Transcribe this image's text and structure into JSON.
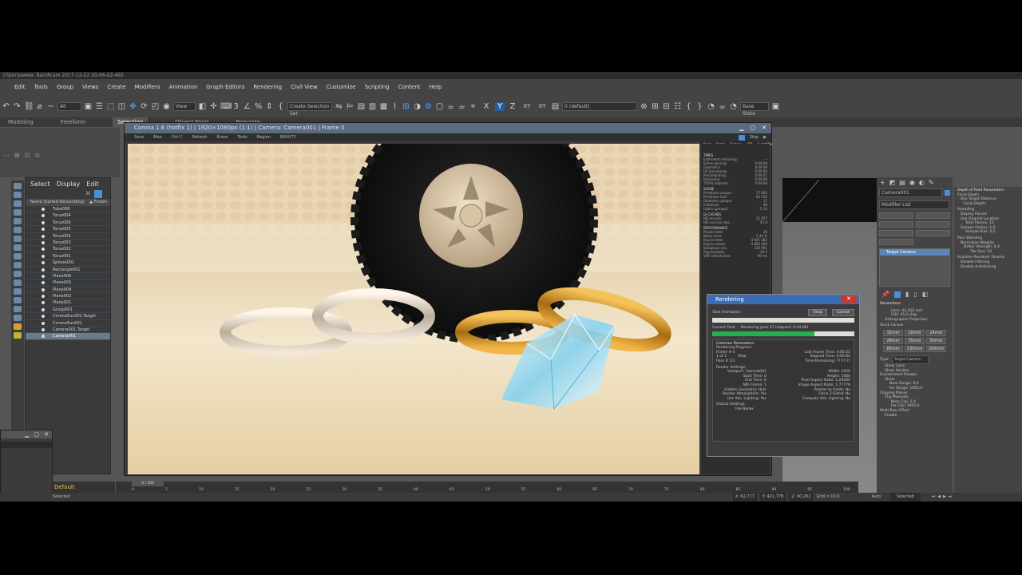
{
  "app": {
    "title": "[Программа: Bandicam 2017-12-22 20-06-02-492"
  },
  "menu": [
    "Edit",
    "Tools",
    "Group",
    "Views",
    "Create",
    "Modifiers",
    "Animation",
    "Graph Editors",
    "Rendering",
    "Civil View",
    "Customize",
    "Scripting",
    "Content",
    "Help"
  ],
  "toolbar": {
    "selection_filter": "All",
    "ref_coord": "View",
    "named_selection": "Create Selection Set",
    "axes": [
      "X",
      "Y",
      "Z",
      "XY",
      "XY"
    ],
    "layer": "0 (default)",
    "state": "Base State"
  },
  "ribbon": {
    "tabs": [
      "Modeling",
      "Freeform",
      "Selection",
      "Object Paint",
      "Populate"
    ]
  },
  "scene_explorer": {
    "tabs": [
      "Select",
      "Display",
      "Edit"
    ],
    "column_name": "Name (Sorted Descending)",
    "column_frozen": "▲ Frozen",
    "items": [
      "Tube008",
      "Torus004",
      "Torus006",
      "Torus005",
      "Torus004",
      "Torus003",
      "Torus002",
      "Torus001",
      "Sphere001",
      "Rectangle001",
      "Plane006",
      "Plane005",
      "Plane004",
      "Plane002",
      "Plane001",
      "Group001",
      "CoronaSun001.Target",
      "CoronaSun001",
      "Camera001.Target",
      "Camera001"
    ],
    "selected": "Camera001"
  },
  "vfb": {
    "title": "Corona 1.6 (hotfix 1) | 1920×1080px (1:1) | Camera: Camera001 | Frame 0",
    "tools": [
      "Save",
      "Max",
      "Ctrl C",
      "Refresh",
      "Erase",
      "Tools",
      "Region",
      "BEAUTY"
    ],
    "right_tabs": [
      "Post",
      "Stats",
      "History",
      "DR",
      "LightMix"
    ],
    "stop": "Stop",
    "stats": {
      "times_header": "TIMES",
      "times": [
        [
          "Estimated remaining:",
          "---"
        ],
        [
          "Scene parsing:",
          "0:00:00"
        ],
        [
          "Geometry:",
          "0:00:00"
        ],
        [
          "UV processing:",
          "0:00:00"
        ],
        [
          "Precomputing:",
          "0:00:01"
        ],
        [
          "Denoising:",
          "0:00:00"
        ],
        [
          "TOTAL elapsed:",
          "0:04:06"
        ]
      ],
      "scene_header": "SCENE",
      "scene": [
        [
          "Primitives unique:",
          "77 802"
        ],
        [
          "Primitives inst.:",
          "83 156"
        ],
        [
          "Geometry groups:",
          "11"
        ],
        [
          "Instances:",
          "98"
        ],
        [
          "Lights (groups):",
          "2 (1)"
        ]
      ],
      "cache_header": "GI CACHES",
      "cache": [
        [
          "HD records:",
          "21 877"
        ],
        [
          "HD success rate:",
          "97.8"
        ]
      ],
      "perf_header": "PERFORMANCE",
      "perf": [
        [
          "Passes total:",
          "26"
        ],
        [
          "Noise level:",
          "5.41 %"
        ],
        [
          "Rays/s total:",
          "4 921 282"
        ],
        [
          "Rays/s actual:",
          "4 865 400"
        ],
        [
          "Samples/s act.:",
          "234 591"
        ],
        [
          "Rays/sample:",
          "20.0"
        ],
        [
          "VFB refresh time:",
          "99 ms"
        ]
      ]
    }
  },
  "render_dialog": {
    "title": "Rendering",
    "total_animation": "Total Animation:",
    "current_task_label": "Current Task:",
    "current_task": "Rendering pass 27 (elapsed: 0:04:06)",
    "progress": 0.72,
    "pause": "Stop",
    "cancel": "Cancel",
    "common_params": "Common Parameters",
    "rendering_progress": "Rendering Progress:",
    "frame": "Frame #    0",
    "of": "1  of  1",
    "total": "Total",
    "pass": "Pass #   1/1",
    "last_frame_time": "Last Frame Time:   0:00:25",
    "elapsed_time": "Elapsed Time:   0:05:90",
    "time_remaining": "Time Remaining:   ??:??:??",
    "render_settings": "Render Settings:",
    "settings_left": [
      "Viewport:  Camera001",
      "Start Time:  0",
      "End Time:  0",
      "Nth Frame:  1",
      "Hidden Geometry:  Hide",
      "Render Atmosphere:  Yes",
      "Use Adv. Lighting:  Yes"
    ],
    "settings_right": [
      "Width:  1920",
      "Height:  1080",
      "Pixel Aspect Ratio:  1,00000",
      "Image Aspect Ratio:  1,77778",
      "Render to Fields:  No",
      "Force 2-Sided:  No",
      "Compute Adv. Lighting:  No"
    ],
    "output_settings": "Output Settings:",
    "file_name": "File Name:"
  },
  "command_panel": {
    "object_name": "Camera001",
    "modifier_list": "Modifier List",
    "stack_item": "Target Camera",
    "parameters": "Parameters",
    "lens": "Lens:  42,456  mm",
    "fov": "FOV:  45,0  deg.",
    "ortho": "Orthographic Projection",
    "stock_lenses": "Stock Lenses",
    "lenses": [
      "15mm",
      "20mm",
      "24mm",
      "28mm",
      "35mm",
      "50mm",
      "85mm",
      "135mm",
      "200mm"
    ],
    "type_label": "Type:",
    "type": "Target Camera",
    "show_cone": "Show Cone",
    "show_horizon": "Show Horizon",
    "env_ranges": "Environment Ranges",
    "show": "Show",
    "near_range": "Near Range: 0,0",
    "far_range": "Far Range: 1000,0",
    "clipping": "Clipping Planes",
    "clip_manually": "Clip Manually",
    "near_clip": "Near Clip: 1,0",
    "far_clip": "Far Clip: 1000,0",
    "multi_pass": "Multi-Pass Effect",
    "enable": "Enable"
  },
  "dof_panel": {
    "title": "Depth of Field Parameters",
    "focal_depth": "Focal Depth",
    "use_target": "Use Target Distance",
    "focal_depth_val": "Focal Depth:",
    "sampling": "Sampling",
    "display_passes": "Display Passes",
    "use_original": "Use Original Location",
    "total_passes": "Total Passes:  12",
    "sample_radius": "Sample Radius:  1,0",
    "sample_bias": "Sample Bias:  0,5",
    "pass_blending": "Pass Blending",
    "normalize": "Normalize Weights",
    "dither": "Dither Strength:  0,4",
    "tile_size": "Tile Size:  32",
    "scanline": "Scanline Renderer Params",
    "disable_filter": "Disable Filtering",
    "disable_aa": "Disable Antialiasing"
  },
  "timeline": {
    "frame": "0 / 100",
    "ticks": [
      "0",
      "5",
      "10",
      "15",
      "20",
      "25",
      "30",
      "35",
      "40",
      "45",
      "50",
      "55",
      "60",
      "65",
      "70",
      "75",
      "80",
      "85",
      "90",
      "95",
      "100"
    ]
  },
  "status": {
    "selected": "Selected",
    "x": "X: 62,777",
    "y": "Y: 421,778",
    "z": "Z: 90,262",
    "grid": "Grid = 10,0",
    "auto": "Auto",
    "selected_mode": "Selected",
    "default_layer": "Default"
  }
}
